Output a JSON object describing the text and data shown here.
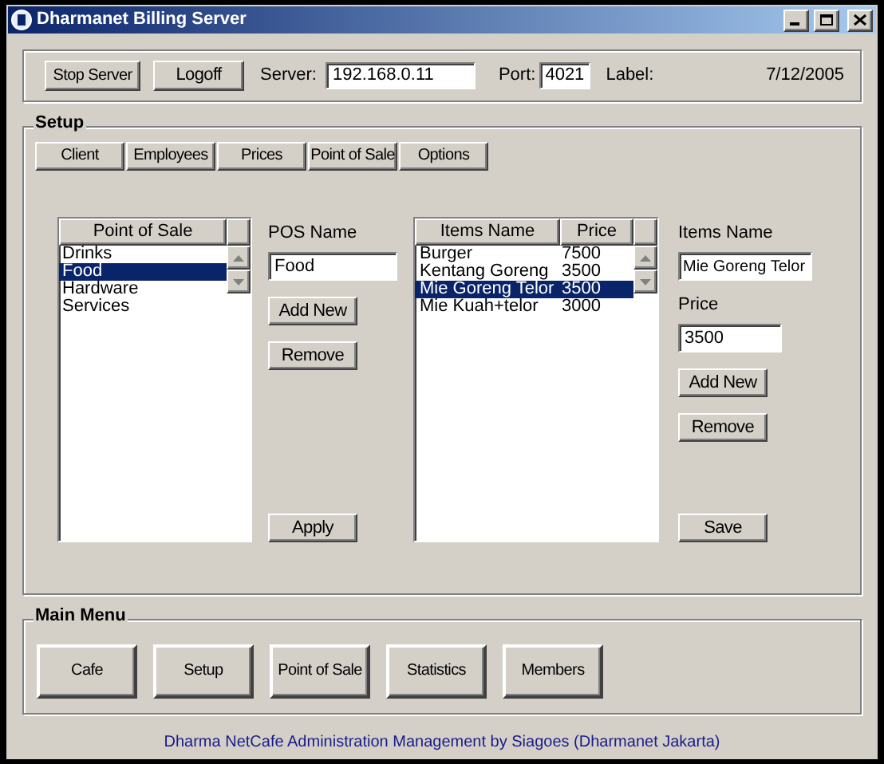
{
  "window": {
    "title": "Dharmanet Billing Server"
  },
  "top_bar": {
    "buttons": [
      "Stop Server",
      "Logoff"
    ],
    "server_label": "Server:",
    "server_value": "192.168.0.11",
    "port_label": "Port:",
    "port_value": "4021",
    "label_text": "Label:",
    "date": "7/12/2005"
  },
  "setup": {
    "title": "Setup",
    "tabs": [
      "Client",
      "Employees",
      "Prices",
      "Point of Sale",
      "Options"
    ],
    "pos_list": {
      "header": "Point of Sale",
      "items": [
        {
          "name": "Drinks",
          "selected": false
        },
        {
          "name": "Food",
          "selected": true
        },
        {
          "name": "Hardware",
          "selected": false
        },
        {
          "name": "Services",
          "selected": false
        }
      ]
    },
    "pos_form": {
      "label": "POS Name",
      "value": "Food",
      "buttons": [
        "Add New",
        "Remove"
      ],
      "apply": "Apply"
    },
    "items_list": {
      "columns": [
        "Items Name",
        "Price"
      ],
      "rows": [
        {
          "name": "Burger",
          "price": "7500",
          "selected": false
        },
        {
          "name": "Kentang Goreng",
          "price": "3500",
          "selected": false
        },
        {
          "name": "Mie Goreng Telor",
          "price": "3500",
          "selected": true
        },
        {
          "name": "Mie Kuah+telor",
          "price": "3000",
          "selected": false
        }
      ]
    },
    "item_form": {
      "name_label": "Items Name",
      "name_value": "Mie Goreng Telor",
      "price_label": "Price",
      "price_value": "3500",
      "buttons": [
        "Add New",
        "Remove"
      ],
      "save": "Save"
    }
  },
  "main_menu": {
    "title": "Main Menu",
    "buttons": [
      "Cafe",
      "Setup",
      "Point of Sale",
      "Statistics",
      "Members"
    ]
  },
  "footer": "Dharma NetCafe Administration Management by Siagoes (Dharmanet Jakarta)"
}
